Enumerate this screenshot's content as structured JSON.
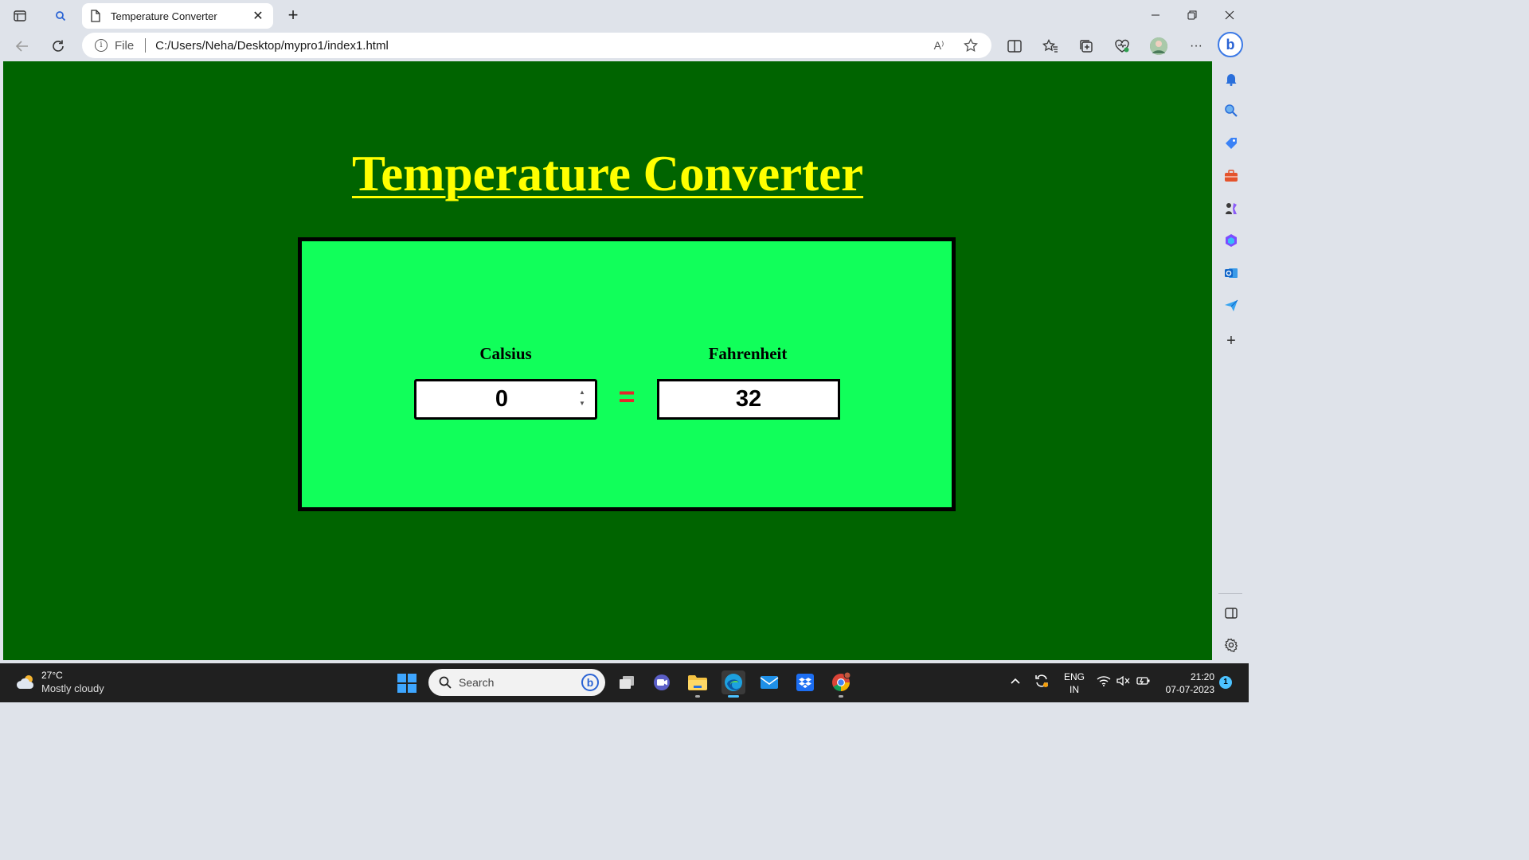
{
  "browser": {
    "tab_title": "Temperature Converter",
    "address": {
      "scheme_label": "File",
      "url": "C:/Users/Neha/Desktop/mypro1/index1.html"
    },
    "toolbar": {
      "read_aloud": "A⁾",
      "more": "···"
    }
  },
  "page": {
    "heading": "Temperature Converter",
    "celsius_label": "Calsius",
    "fahrenheit_label": "Fahrenheit",
    "celsius_value": "0",
    "fahrenheit_value": "32",
    "equals_sign": "=",
    "colors": {
      "background": "#006400",
      "heading": "#ffff00",
      "card": "#11ff5a",
      "equals": "#e4282c"
    }
  },
  "taskbar": {
    "weather_temp": "27°C",
    "weather_desc": "Mostly cloudy",
    "search_placeholder": "Search",
    "language_line1": "ENG",
    "language_line2": "IN",
    "time": "21:20",
    "date": "07-07-2023",
    "notification_count": "1"
  }
}
